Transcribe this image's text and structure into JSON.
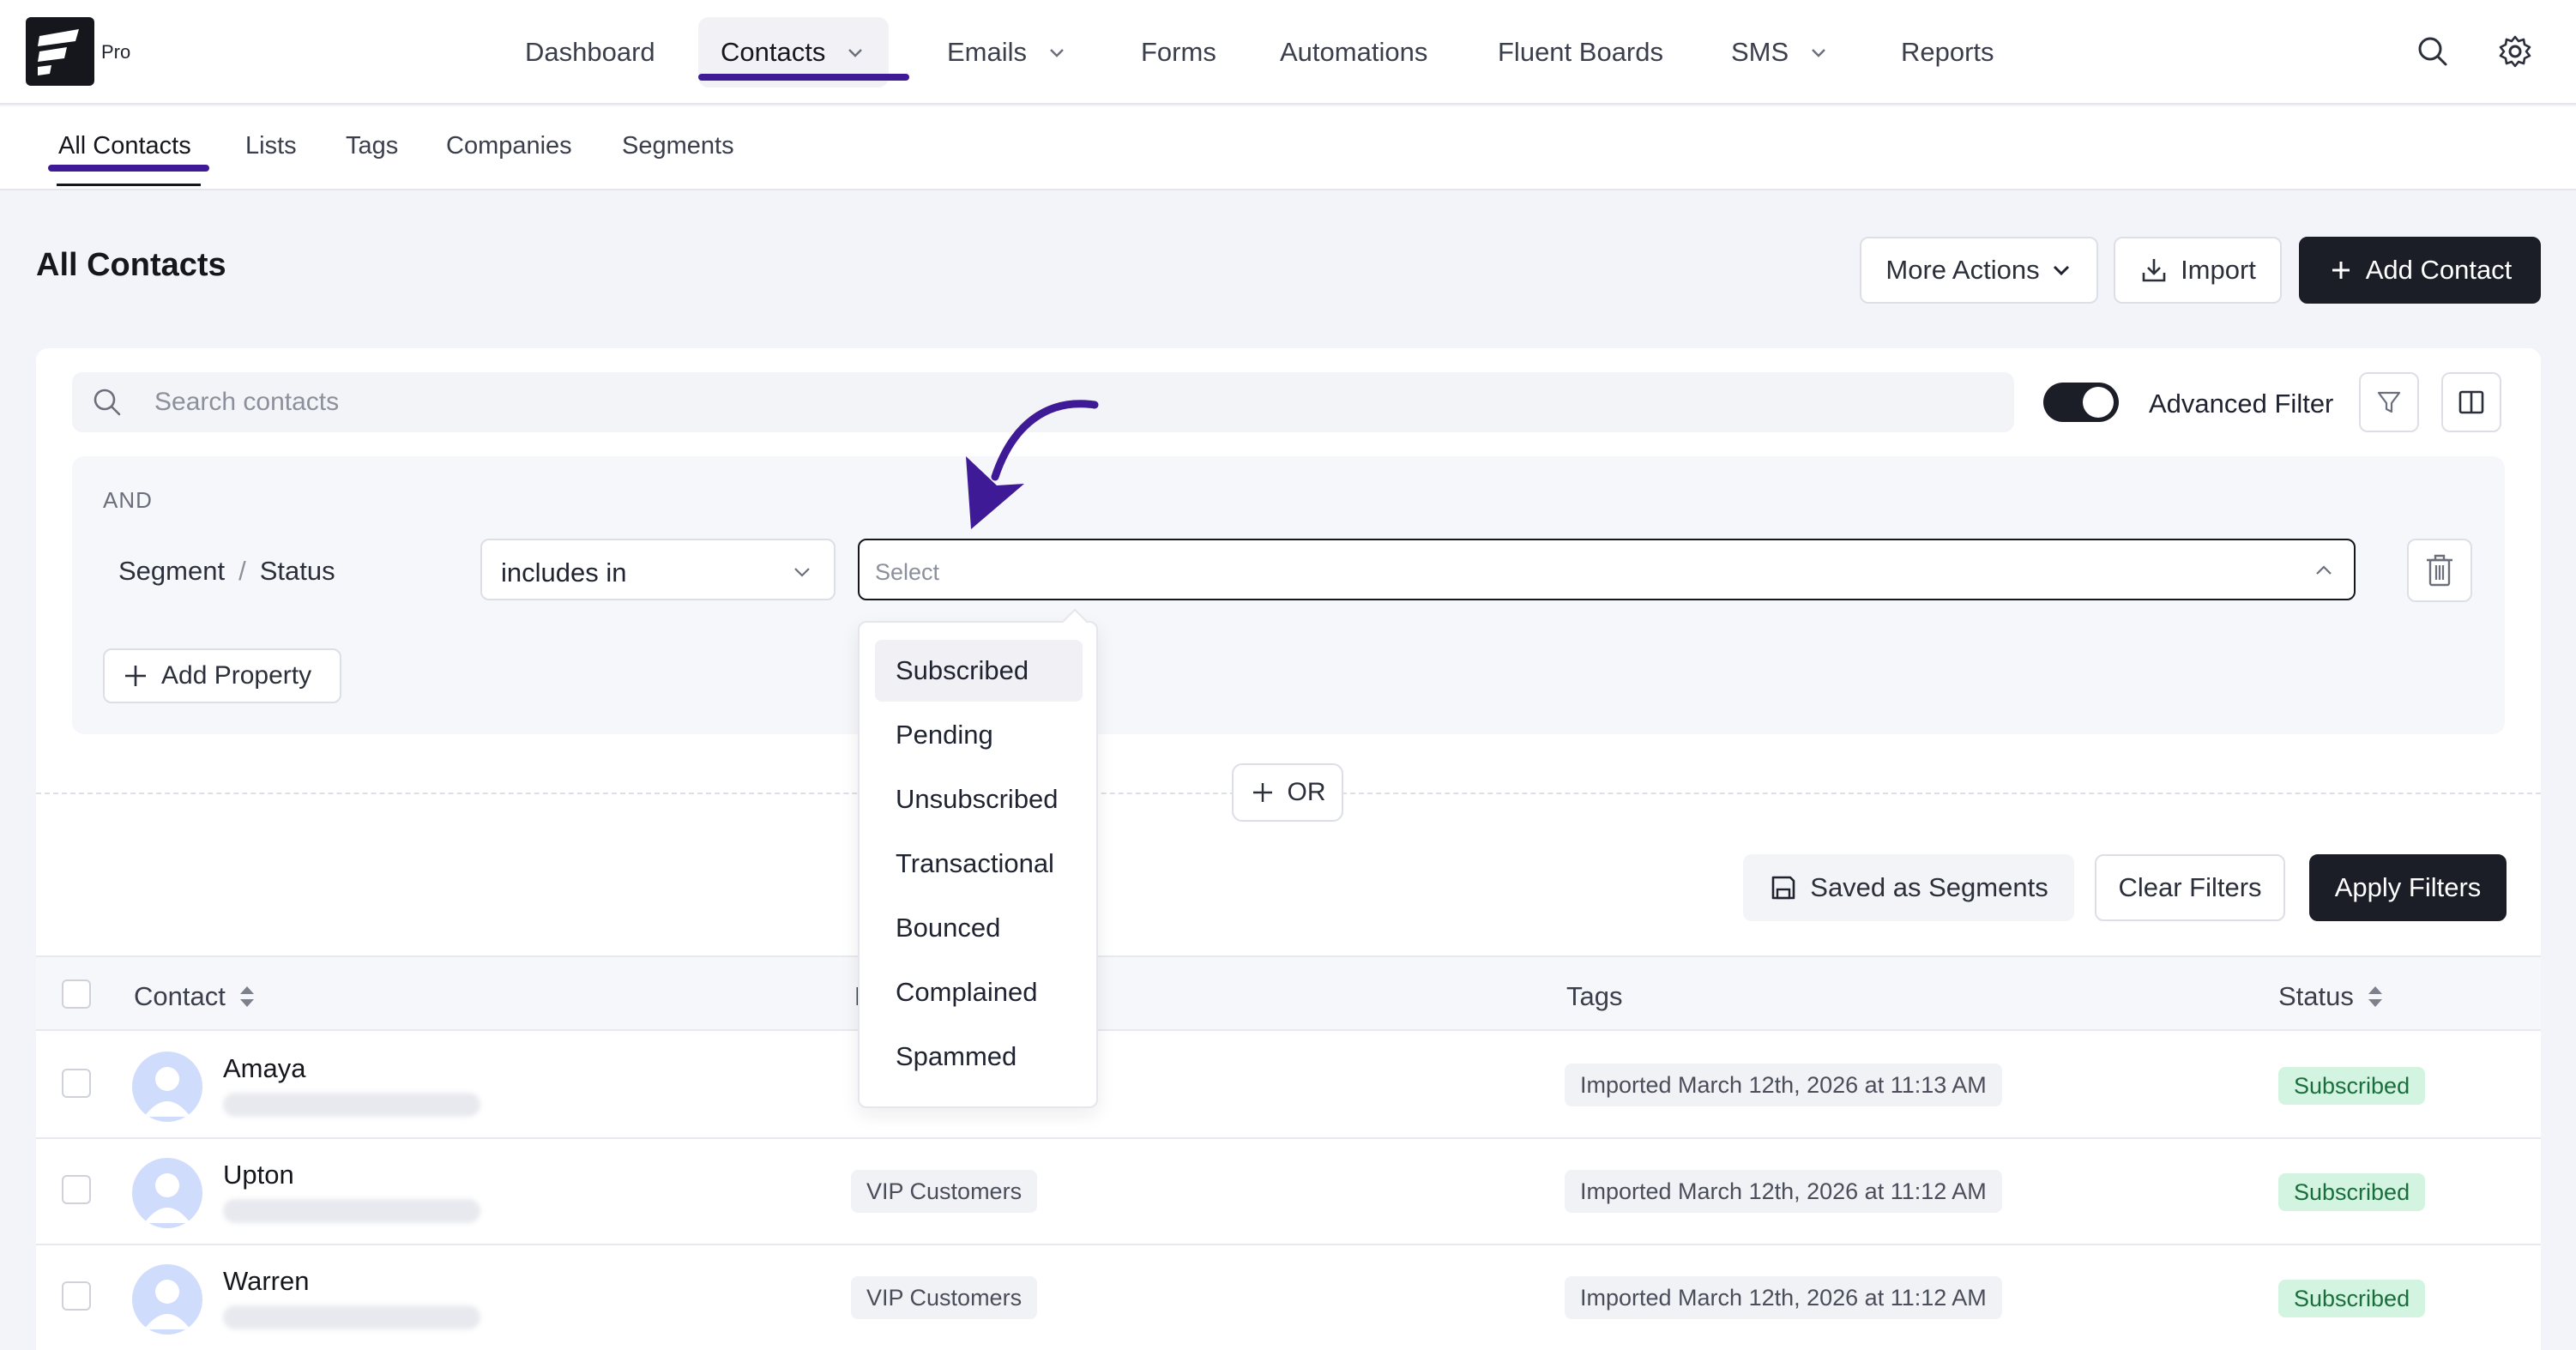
{
  "brand": {
    "badge": "Pro"
  },
  "nav": {
    "items": [
      {
        "label": "Dashboard"
      },
      {
        "label": "Contacts"
      },
      {
        "label": "Emails"
      },
      {
        "label": "Forms"
      },
      {
        "label": "Automations"
      },
      {
        "label": "Fluent Boards"
      },
      {
        "label": "SMS"
      },
      {
        "label": "Reports"
      }
    ],
    "active": "Contacts"
  },
  "subnav": {
    "items": [
      {
        "label": "All Contacts"
      },
      {
        "label": "Lists"
      },
      {
        "label": "Tags"
      },
      {
        "label": "Companies"
      },
      {
        "label": "Segments"
      }
    ]
  },
  "page": {
    "title": "All Contacts",
    "more_actions": "More Actions",
    "import": "Import",
    "add_contact": "Add Contact"
  },
  "search": {
    "placeholder": "Search contacts"
  },
  "advanced_filter": {
    "label": "Advanced Filter",
    "enabled": true
  },
  "filter": {
    "group_label": "AND",
    "property_group": "Segment",
    "property_sep": "/",
    "property": "Status",
    "operator": "includes in",
    "value_placeholder": "Select",
    "add_property": "Add Property",
    "or_label": "OR",
    "saved_segments": "Saved as Segments",
    "clear": "Clear Filters",
    "apply": "Apply Filters"
  },
  "dropdown": {
    "options": [
      "Subscribed",
      "Pending",
      "Unsubscribed",
      "Transactional",
      "Bounced",
      "Complained",
      "Spammed"
    ],
    "highlighted": "Subscribed"
  },
  "table": {
    "headers": {
      "contact": "Contact",
      "lists_partial": "L",
      "tags": "Tags",
      "status": "Status"
    },
    "rows": [
      {
        "name": "Amaya",
        "list": "",
        "tag": "Imported March 12th, 2026 at 11:13 AM",
        "status": "Subscribed"
      },
      {
        "name": "Upton",
        "list": "VIP Customers",
        "tag": "Imported March 12th, 2026 at 11:12 AM",
        "status": "Subscribed"
      },
      {
        "name": "Warren",
        "list": "VIP Customers",
        "tag": "Imported March 12th, 2026 at 11:12 AM",
        "status": "Subscribed"
      }
    ]
  },
  "colors": {
    "accent": "#3f1a97",
    "dark_button": "#1b1e27",
    "status_bg": "#d3f4e0",
    "status_text": "#1a6e3d"
  }
}
